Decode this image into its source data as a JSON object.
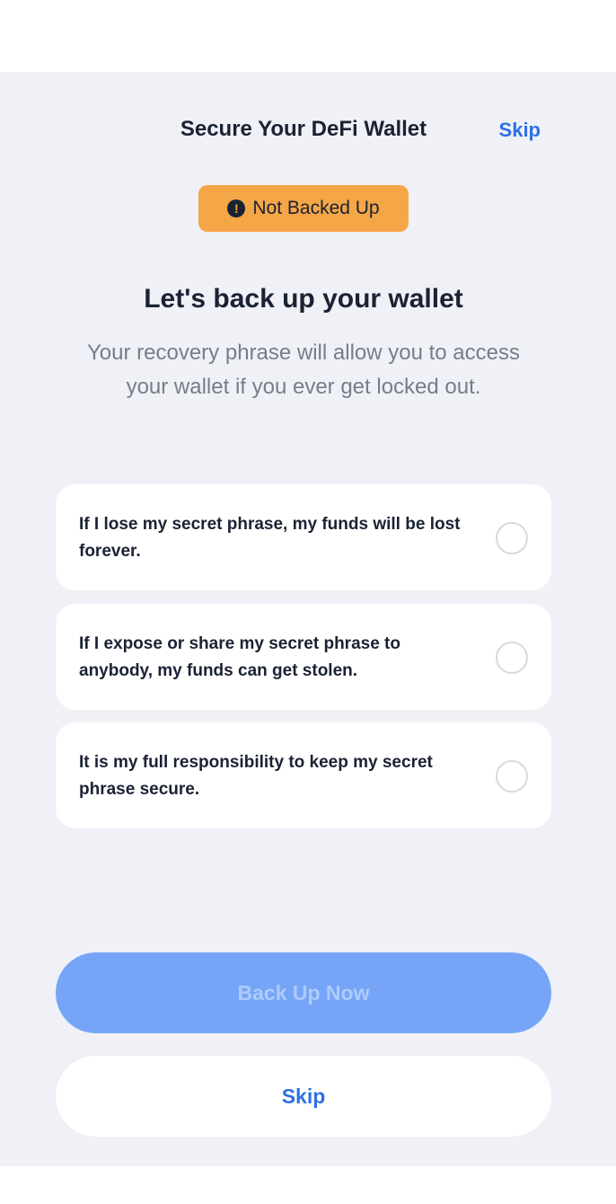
{
  "header": {
    "title": "Secure Your DeFi Wallet",
    "skip_label": "Skip"
  },
  "badge": {
    "icon": "exclamation-icon",
    "icon_glyph": "!",
    "label": "Not Backed Up",
    "color": "#f5a646"
  },
  "content": {
    "headline": "Let's back up your wallet",
    "subtext": "Your recovery phrase will allow you to access your wallet if you ever get locked out."
  },
  "checklist": [
    {
      "text": "If I lose my secret phrase, my funds will be lost forever.",
      "checked": false
    },
    {
      "text": "If I expose or share my secret phrase to anybody, my funds can get stolen.",
      "checked": false
    },
    {
      "text": "It is my full responsibility to keep my secret phrase secure.",
      "checked": false
    }
  ],
  "actions": {
    "primary_label": "Back Up Now",
    "primary_disabled": true,
    "secondary_label": "Skip"
  },
  "colors": {
    "accent": "#2f6fe4",
    "primary_disabled": "#76a5f8",
    "background": "#eff1f6",
    "text": "#1a2233",
    "muted": "#767d8a"
  }
}
